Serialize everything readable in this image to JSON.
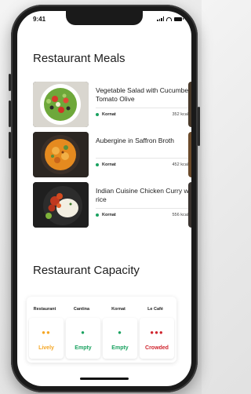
{
  "status_bar": {
    "time": "9:41"
  },
  "meals_section": {
    "title": "Restaurant Meals",
    "items": [
      {
        "name": "Vegetable Salad with Cucumber Tomato Olive",
        "location": "Kornat",
        "kcal": "352 kcal"
      },
      {
        "name": "Aubergine in Saffron Broth",
        "location": "Kornat",
        "kcal": "452 kcal"
      },
      {
        "name": "Indian Cuisine Chicken Curry with rice",
        "location": "Kornat",
        "kcal": "556 kcal"
      }
    ]
  },
  "capacity_section": {
    "title": "Restaurant Capacity",
    "restaurants": [
      {
        "name": "Restaurant",
        "status": "Lively",
        "status_color": "#f5a623",
        "people": 2
      },
      {
        "name": "Cantina",
        "status": "Empty",
        "status_color": "#1aa260",
        "people": 1
      },
      {
        "name": "Kornat",
        "status": "Empty",
        "status_color": "#1aa260",
        "people": 1
      },
      {
        "name": "Le Café",
        "status": "Crowded",
        "status_color": "#d0262f",
        "people": 3
      }
    ]
  },
  "colors": {
    "status_dot": "#1aa260",
    "lively": "#f5a623",
    "empty": "#1aa260",
    "crowded": "#d0262f"
  }
}
